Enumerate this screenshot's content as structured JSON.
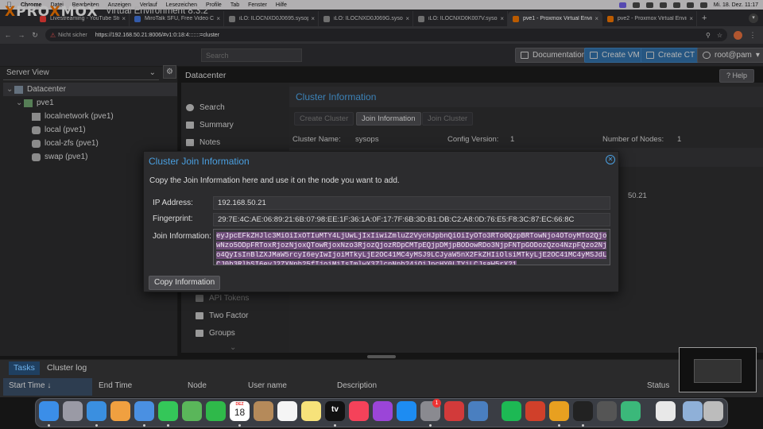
{
  "menubar": {
    "app": "Chrome",
    "items": [
      "Datei",
      "Bearbeiten",
      "Anzeigen",
      "Verlauf",
      "Lesezeichen",
      "Profile",
      "Tab",
      "Fenster",
      "Hilfe"
    ],
    "clock": "Mi. 18. Dez. 11:17"
  },
  "browser": {
    "tabs": [
      {
        "title": "Livestreaming - YouTube Studio",
        "color": "#e53935"
      },
      {
        "title": "MiroTalk SFU, Free Video Calls",
        "color": "#3f6fd0"
      },
      {
        "title": "iLO: ILOCNXD0J0695.sysops",
        "color": "#888888"
      },
      {
        "title": "iLO: ILOCNXD0J069G.sysops",
        "color": "#888888"
      },
      {
        "title": "iLO: ILOCNXD0K007V.sysops",
        "color": "#888888"
      },
      {
        "title": "pve1 - Proxmox Virtual Environment",
        "color": "#e57000"
      },
      {
        "title": "pve2 - Proxmox Virtual Environment",
        "color": "#e57000"
      }
    ],
    "not_secure": "Nicht sicher",
    "url": "https://192.168.50.21:8006/#v1:0:18:4:::::::=cluster"
  },
  "pve": {
    "logo": "PROXMOX",
    "logo_x": "X",
    "logo_pre": "PRO",
    "logo_post": "MOX",
    "version": "Virtual Environment 8.3.2",
    "search_placeholder": "Search",
    "documentation": "Documentation",
    "create_vm": "Create VM",
    "create_ct": "Create CT",
    "user": "root@pam",
    "server_view": "Server View",
    "tree": {
      "datacenter": "Datacenter",
      "node": "pve1",
      "items": [
        "localnetwork (pve1)",
        "local (pve1)",
        "local-zfs (pve1)",
        "swap (pve1)"
      ]
    },
    "breadcrumb": "Datacenter",
    "help": "Help",
    "nav_top": [
      "Search",
      "Summary",
      "Notes"
    ],
    "nav_bottom": [
      "API Tokens",
      "Two Factor",
      "Groups"
    ],
    "cluster_title": "Cluster Information",
    "buttons": {
      "create": "Create Cluster",
      "join_info": "Join Information",
      "join": "Join Cluster"
    },
    "cluster_name_label": "Cluster Name:",
    "cluster_name": "sysops",
    "config_version_label": "Config Version:",
    "config_version": "1",
    "num_nodes_label": "Number of Nodes:",
    "num_nodes": "1",
    "node_ip_partial": "50.21"
  },
  "dialog": {
    "title": "Cluster Join Information",
    "intro": "Copy the Join Information here and use it on the node you want to add.",
    "ip_label": "IP Address:",
    "ip": "192.168.50.21",
    "fp_label": "Fingerprint:",
    "fingerprint": "29:7E:4C:AE:06:89:21:6B:07:98:EE:1F:36:1A:0F:17:7F:6B:3D:B1:DB:C2:A8:0D:76:E5:F8:3C:87:EC:66:8C",
    "join_label": "Join Information:",
    "join_info": "eyJpcEFkZHJlc3MiOiIxOTIuMTY4LjUwLjIxIiwiZmluZ2VycHJpbnQiOiIyOTo3RTo0QzpBRTowNjo4OToyMTo2QjowNzo5ODpFRToxRjozNjoxQTowRjoxNzo3RjozQjozRDpCMTpEQjpDMjpBODowRDo3NjpFNTpGODozQzo4NzpFQzo2Njo4QyIsInBlZXJMaW5rcyI6eyIwIjoiMTkyLjE2OC41MC4yMSJ9LCJyaW5nX2FkZHIiOlsiMTkyLjE2OC41MC4yMSJdLCJ0b3RlbSI6eyJ2ZXNpb25fIjoiMiIsImlwX3ZlcnNpb24iOiJpcHY0LTYiLCJsaW5rX21",
    "copy": "Copy Information"
  },
  "tasks": {
    "tabs": [
      "Tasks",
      "Cluster log"
    ],
    "columns": [
      "Start Time ↓",
      "End Time",
      "Node",
      "User name",
      "Description",
      "Status"
    ]
  },
  "dock": {
    "calendar_month": "DEZ",
    "calendar_day": "18",
    "tv_label": "tv",
    "badge": "1",
    "apps": [
      {
        "name": "finder-icon",
        "color": "#3b8ee8"
      },
      {
        "name": "launchpad-icon",
        "color": "#9a9aa5"
      },
      {
        "name": "safari-icon",
        "color": "#3a8fe0"
      },
      {
        "name": "photos-icon",
        "color": "#f0a040"
      },
      {
        "name": "mail-icon",
        "color": "#4a90e2"
      },
      {
        "name": "messages-icon",
        "color": "#34c759"
      },
      {
        "name": "maps-icon",
        "color": "#5ab65a"
      },
      {
        "name": "facetime-icon",
        "color": "#2fb94a"
      },
      {
        "name": "calendar-icon",
        "color": "#ffffff"
      },
      {
        "name": "contacts-icon",
        "color": "#b58a5a"
      },
      {
        "name": "reminders-icon",
        "color": "#f5f5f5"
      },
      {
        "name": "notes-icon",
        "color": "#f7e27a"
      },
      {
        "name": "appletv-icon",
        "color": "#111111"
      },
      {
        "name": "music-icon",
        "color": "#f5425a"
      },
      {
        "name": "podcasts-icon",
        "color": "#9b45d8"
      },
      {
        "name": "appstore-icon",
        "color": "#1d8cf2"
      },
      {
        "name": "settings-icon",
        "color": "#8a8a90"
      },
      {
        "name": "screenrec-icon",
        "color": "#d23a3a"
      },
      {
        "name": "network-icon",
        "color": "#4a7fc0"
      },
      {
        "name": "spotify-icon",
        "color": "#1db954"
      },
      {
        "name": "app-red-icon",
        "color": "#d0402a"
      },
      {
        "name": "chrome-icon",
        "color": "#e8a020"
      },
      {
        "name": "terminal-icon",
        "color": "#222222"
      },
      {
        "name": "calculator-icon",
        "color": "#555555"
      },
      {
        "name": "sync-icon",
        "color": "#3bb87a"
      },
      {
        "name": "document-icon",
        "color": "#e8e8e8"
      },
      {
        "name": "downloads-icon",
        "color": "#8fb0d8"
      },
      {
        "name": "trash-icon",
        "color": "#bcbcbc"
      }
    ]
  }
}
